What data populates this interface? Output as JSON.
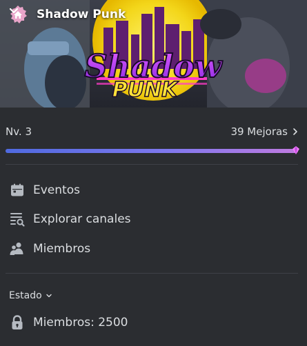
{
  "server": {
    "name": "Shadow Punk",
    "banner_logo_line1": "Shadow",
    "banner_logo_line2": "PUNK",
    "icon": "home-icon",
    "collapse_icon": "chevron-down-icon"
  },
  "boost": {
    "level_label": "Nv. 3",
    "count_label": "39 Mejoras",
    "progress": 1.0,
    "arrow_icon": "chevron-right-icon"
  },
  "menu": {
    "items": [
      {
        "label": "Eventos",
        "icon": "calendar-icon"
      },
      {
        "label": "Explorar canales",
        "icon": "browse-channels-icon"
      },
      {
        "label": "Miembros",
        "icon": "members-icon"
      }
    ]
  },
  "stats": {
    "section_label": "Estado",
    "members_label": "Miembros: 2500",
    "members_icon": "lock-icon"
  },
  "colors": {
    "background": "#2b2d31",
    "text": "#dbdee1",
    "progress_start": "#4f6ae0",
    "progress_end": "#c07be0",
    "server_icon_bg": "#e8a4c9"
  }
}
